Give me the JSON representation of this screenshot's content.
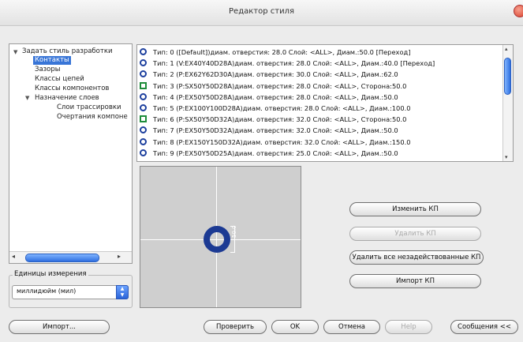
{
  "window": {
    "title": "Редактор стиля"
  },
  "tree": {
    "items": [
      {
        "label": "Задать стиль разработки",
        "expanded": true
      },
      {
        "label": "Контакты",
        "selected": true
      },
      {
        "label": "Зазоры"
      },
      {
        "label": "Классы цепей"
      },
      {
        "label": "Классы компонентов"
      },
      {
        "label": "Назначение слоев",
        "expanded": true
      },
      {
        "label": "Слои трассировки"
      },
      {
        "label": "Очертания компоне"
      }
    ]
  },
  "units": {
    "label": "Единицы измерения",
    "value": "миллидюйм (мил)"
  },
  "pads": [
    {
      "text": "Тип: 0 ([Default])диам. отверстия: 28.0 Слой: <ALL>, Диам.:50.0   [Переход]",
      "shape": "round"
    },
    {
      "text": "Тип: 1 (V:EX40Y40D28A)диам. отверстия: 28.0 Слой: <ALL>, Диам.:40.0   [Переход]",
      "shape": "round"
    },
    {
      "text": "Тип: 2 (P:EX62Y62D30A)диам. отверстия: 30.0 Слой: <ALL>, Диам.:62.0",
      "shape": "round"
    },
    {
      "text": "Тип: 3 (P:SX50Y50D28A)диам. отверстия: 28.0 Слой: <ALL>, Сторона:50.0",
      "shape": "square"
    },
    {
      "text": "Тип: 4 (P:EX50Y50D28A)диам. отверстия: 28.0 Слой: <ALL>, Диам.:50.0",
      "shape": "round"
    },
    {
      "text": "Тип: 5 (P:EX100Y100D28A)диам. отверстия: 28.0 Слой: <ALL>, Диам.:100.0",
      "shape": "round"
    },
    {
      "text": "Тип: 6 (P:SX50Y50D32A)диам. отверстия: 32.0 Слой: <ALL>, Сторона:50.0",
      "shape": "square"
    },
    {
      "text": "Тип: 7 (P:EX50Y50D32A)диам. отверстия: 32.0 Слой: <ALL>, Диам.:50.0",
      "shape": "round"
    },
    {
      "text": "Тип: 8 (P:EX150Y150D32A)диам. отверстия: 32.0 Слой: <ALL>, Диам.:150.0",
      "shape": "round"
    },
    {
      "text": "Тип: 9 (P:EX50Y50D25A)диам. отверстия: 25.0 Слой: <ALL>, Диам.:50.0",
      "shape": "round"
    }
  ],
  "preview": {
    "dimension": "50.0"
  },
  "actions": {
    "edit": "Изменить КП",
    "delete": "Удалить КП",
    "delete_unused": "Удалить все незадействованные КП",
    "import_pad": "Импорт КП"
  },
  "footer": {
    "import": "Импорт...",
    "check": "Проверить",
    "ok": "OK",
    "cancel": "Отмена",
    "help": "Help",
    "messages": "Сообщения <<"
  },
  "colors": {
    "selection": "#3875d7",
    "pad_round": "#1c3a93",
    "pad_square": "#1e8c3a"
  }
}
